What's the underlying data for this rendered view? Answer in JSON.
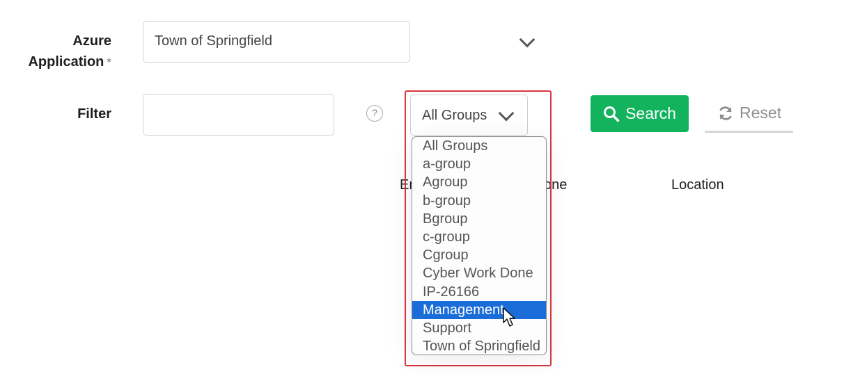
{
  "form": {
    "azure_label_line1": "Azure",
    "azure_label_line2": "Application",
    "required_mark": "*",
    "azure_value": "Town of Springfield",
    "filter_label": "Filter",
    "filter_value": "",
    "help_glyph": "?",
    "group_value": "All Groups"
  },
  "buttons": {
    "search_label": "Search",
    "reset_label": "Reset"
  },
  "table_headers": {
    "col1_partial": "Em",
    "col2_partial": "one",
    "col3": "Location"
  },
  "group_dropdown": {
    "options": [
      "All Groups",
      "a-group",
      "Agroup",
      "b-group",
      "Bgroup",
      "c-group",
      "Cgroup",
      "Cyber Work Done",
      "IP-26166",
      "Management",
      "Support",
      "Town of Springfield"
    ],
    "highlighted": "Management"
  },
  "colors": {
    "search_button": "#13b35e",
    "highlight_border": "#d9363e",
    "selected_option": "#1a6dd8"
  },
  "icons": [
    "chevron-down-icon",
    "help-icon",
    "search-icon",
    "refresh-icon",
    "mouse-cursor-icon"
  ]
}
